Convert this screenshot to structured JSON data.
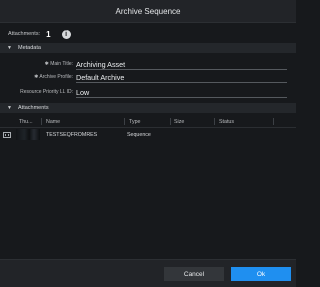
{
  "dialog": {
    "title": "Archive Sequence"
  },
  "attachments_summary": {
    "label": "Attachments:",
    "count": "1",
    "info_icon": "info-icon"
  },
  "metadata": {
    "section_label": "Metadata",
    "fields": [
      {
        "label": "✱ Main Title:",
        "value": "Archiving Asset"
      },
      {
        "label": "✱ Archive Profile:",
        "value": "Default Archive"
      },
      {
        "label": "Resource Priority LL ID:",
        "value": "Low"
      }
    ]
  },
  "attachments": {
    "section_label": "Attachments",
    "columns": [
      "Thu...",
      "Name",
      "Type",
      "Size",
      "Status"
    ],
    "rows": [
      {
        "icon": "film-icon",
        "name": "TESTSEQFROMRES",
        "type": "Sequence",
        "size": "",
        "status": ""
      }
    ]
  },
  "footer": {
    "cancel_label": "Cancel",
    "ok_label": "Ok"
  },
  "colors": {
    "accent": "#1f8ff0",
    "background": "#17191c",
    "header": "#24272b"
  }
}
